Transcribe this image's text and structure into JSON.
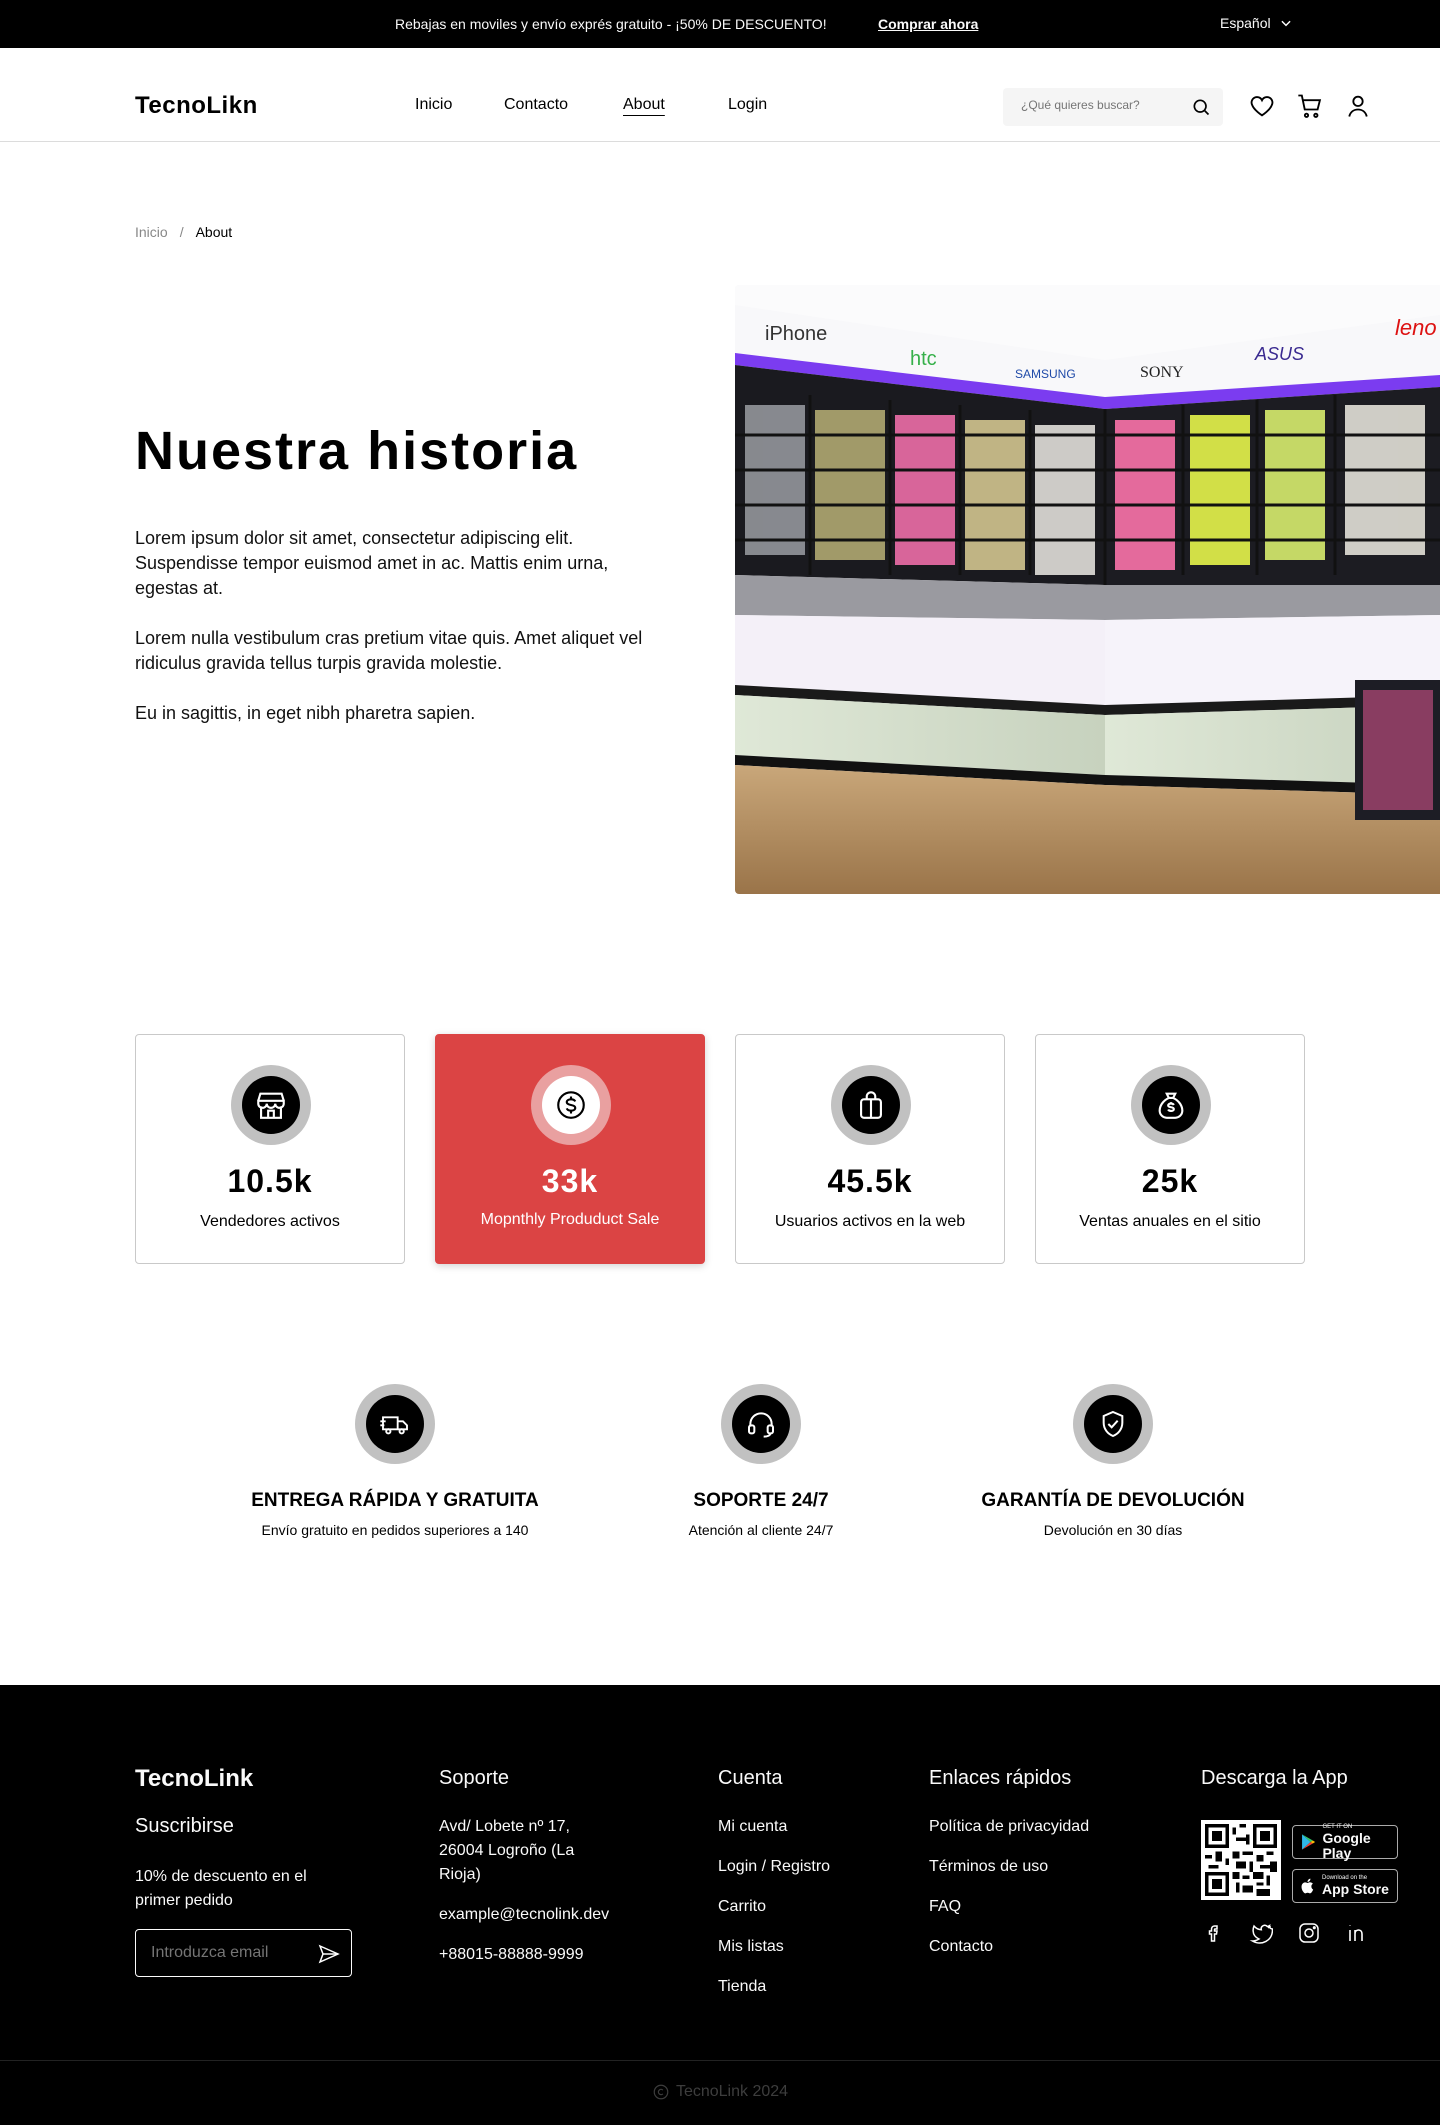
{
  "topbar": {
    "promo": "Rebajas en moviles y envío exprés gratuito - ¡50% DE DESCUENTO!",
    "shop_now": "Comprar ahora",
    "language": "Español"
  },
  "header": {
    "logo": "TecnoLikn",
    "nav": [
      "Inicio",
      "Contacto",
      "About",
      "Login"
    ],
    "active_nav": "About",
    "search_placeholder": "¿Qué quieres buscar?"
  },
  "breadcrumb": [
    "Inicio",
    "About"
  ],
  "story": {
    "title": "Nuestra historia",
    "paragraphs": [
      "Lorem ipsum dolor sit amet, consectetur adipiscing elit. Suspendisse tempor euismod amet in ac. Mattis enim urna, egestas at.",
      "Lorem nulla vestibulum cras pretium vitae quis. Amet aliquet vel ridiculus gravida tellus turpis gravida molestie.",
      "Eu in sagittis, in eget nibh pharetra sapien."
    ],
    "image_brands": [
      "iPhone",
      "htc",
      "SAMSUNG",
      "SONY",
      "ASUS",
      "leno"
    ]
  },
  "stats": [
    {
      "value": "10.5k",
      "label": "Vendedores activos",
      "icon": "shop-icon"
    },
    {
      "value": "33k",
      "label": "Mopnthly Produduct Sale",
      "icon": "dollar-icon",
      "highlight": true
    },
    {
      "value": "45.5k",
      "label": "Usuarios activos en la web",
      "icon": "shopping-bag-icon"
    },
    {
      "value": "25k",
      "label": "Ventas anuales en el sitio",
      "icon": "money-bag-icon"
    }
  ],
  "services": [
    {
      "title": "ENTREGA RÁPIDA Y GRATUITA",
      "desc": "Envío gratuito en pedidos superiores a 140",
      "icon": "delivery-truck-icon"
    },
    {
      "title": "SOPORTE 24/7",
      "desc": "Atención al cliente 24/7",
      "icon": "headset-icon"
    },
    {
      "title": "GARANTÍA DE DEVOLUCIÓN",
      "desc": "Devolución en 30 días",
      "icon": "shield-check-icon"
    }
  ],
  "footer": {
    "logo": "TecnoLink",
    "subscribe_title": "Suscribirse",
    "subscribe_text": "10% de descuento en el primer pedido",
    "email_placeholder": "Introduzca email",
    "support_title": "Soporte",
    "support_address": "Avd/ Lobete nº 17, 26004 Logroño (La Rioja)",
    "support_email": "example@tecnolink.dev",
    "support_phone": "+88015-88888-9999",
    "account_title": "Cuenta",
    "account_links": [
      "Mi cuenta",
      "Login / Registro",
      "Carrito",
      "Mis listas",
      "Tienda"
    ],
    "quick_title": "Enlaces rápidos",
    "quick_links": [
      "Política de privacyidad",
      "Términos de uso",
      "FAQ",
      "Contacto"
    ],
    "app_title": "Descarga la App",
    "google_small": "GET IT ON",
    "google_big": "Google Play",
    "apple_small": "Download on the",
    "apple_big": "App Store",
    "copyright": "TecnoLink 2024"
  },
  "colors": {
    "accent": "#db4444",
    "dark": "#000000",
    "ring": "#c1c1c1"
  }
}
